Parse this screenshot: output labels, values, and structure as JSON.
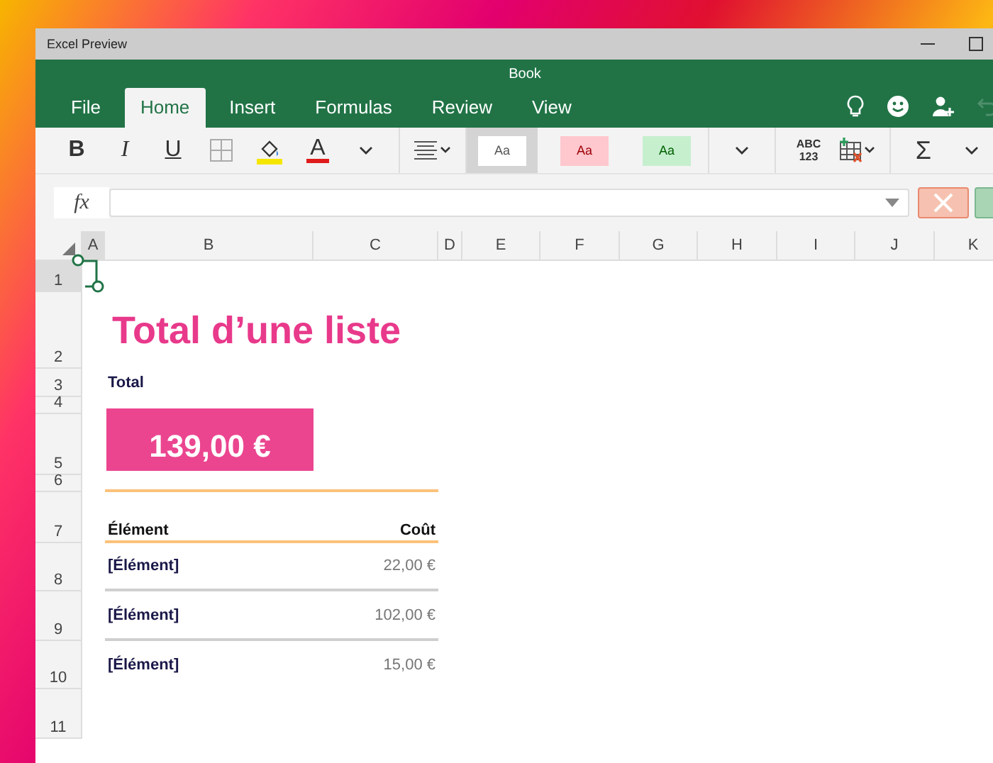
{
  "window": {
    "title": "Excel Preview"
  },
  "document_title": "Book",
  "tabs": [
    {
      "label": "File",
      "selected": false
    },
    {
      "label": "Home",
      "selected": true
    },
    {
      "label": "Insert",
      "selected": false
    },
    {
      "label": "Formulas",
      "selected": false
    },
    {
      "label": "Review",
      "selected": false
    },
    {
      "label": "View",
      "selected": false
    }
  ],
  "ribbon": {
    "bold": "B",
    "italic": "I",
    "underline": "U",
    "font_color": "A",
    "styles": [
      {
        "label": "Aa",
        "kind": "normal",
        "selected": true
      },
      {
        "label": "Aa",
        "kind": "bad",
        "selected": false
      },
      {
        "label": "Aa",
        "kind": "good",
        "selected": false
      }
    ],
    "number_format": [
      "ABC",
      "123"
    ],
    "sum": "Σ"
  },
  "formula_bar": {
    "label": "fx"
  },
  "column_headers": [
    {
      "label": "A",
      "selected": true
    },
    {
      "label": "B",
      "selected": false
    },
    {
      "label": "C",
      "selected": false
    },
    {
      "label": "D",
      "selected": false
    },
    {
      "label": "E",
      "selected": false
    },
    {
      "label": "F",
      "selected": false
    },
    {
      "label": "G",
      "selected": false
    },
    {
      "label": "H",
      "selected": false
    },
    {
      "label": "I",
      "selected": false
    },
    {
      "label": "J",
      "selected": false
    },
    {
      "label": "K",
      "selected": false
    }
  ],
  "row_headers": [
    {
      "label": "1",
      "selected": true
    },
    {
      "label": "2",
      "selected": false
    },
    {
      "label": "3",
      "selected": false
    },
    {
      "label": "4",
      "selected": false
    },
    {
      "label": "5",
      "selected": false
    },
    {
      "label": "6",
      "selected": false
    },
    {
      "label": "7",
      "selected": false
    },
    {
      "label": "8",
      "selected": false
    },
    {
      "label": "9",
      "selected": false
    },
    {
      "label": "10",
      "selected": false
    },
    {
      "label": "11",
      "selected": false
    }
  ],
  "sheet": {
    "title": "Total d’une liste",
    "total_label": "Total",
    "total_value": "139,00 €",
    "table": {
      "columns": [
        "Élément",
        "Coût"
      ],
      "rows": [
        [
          "[Élément]",
          "22,00 €"
        ],
        [
          "[Élément]",
          "102,00 €"
        ],
        [
          "[Élément]",
          "15,00 €"
        ]
      ]
    }
  }
}
